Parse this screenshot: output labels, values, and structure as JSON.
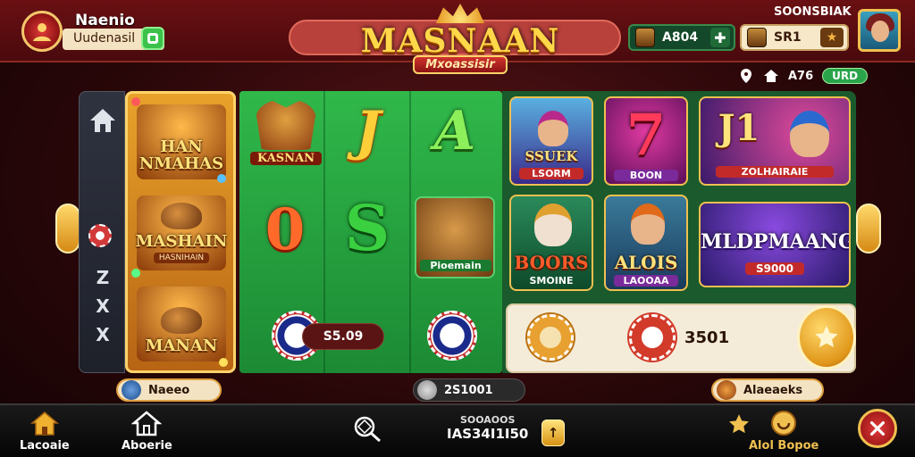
{
  "header": {
    "player_name": "Naenio",
    "player_sub": "Uudenasil",
    "logo_title": "MASNAAN",
    "logo_ribbon": "Mxoassisir",
    "balance_label": "SOONSBIAK",
    "chip_green_value": "A804",
    "chip_cream_value": "SR1",
    "status_text": "A76",
    "status_badge": "URD"
  },
  "left_rail": {
    "symbols": [
      "Z",
      "X",
      "X"
    ]
  },
  "featured": {
    "cards": [
      {
        "title": "HAN NMAHAS"
      },
      {
        "title": "MASHAIN",
        "sub": "HASNIHAIN"
      },
      {
        "title": "MANAN"
      }
    ]
  },
  "slot_grid": {
    "mask_label": "KASNAN",
    "sym_j": "J",
    "sym_a": "A",
    "sym_0": "0",
    "sym_s": "S",
    "lion_label": "Pioemain",
    "amount": "S5.09"
  },
  "games": [
    {
      "title": "SSUEK",
      "sub": "LSORM"
    },
    {
      "title": "7",
      "sub": "BOON"
    },
    {
      "title": "J1",
      "sub": "ZOLHAIRAIE"
    },
    {
      "title": "BOORS",
      "sub": "SMOINE"
    },
    {
      "title": "ALOIS",
      "sub": "LAOOAA"
    },
    {
      "title": "MLDPMAANG",
      "sub": "S9000"
    }
  ],
  "bet_panel": {
    "amount": "3501"
  },
  "under_row": {
    "left_label": "Naeeo",
    "mid_label": "2S1001",
    "right_label": "Alaeaeks"
  },
  "bottom_nav": {
    "home_label": "Lacoaie",
    "aboerie_label": "Aboerie",
    "counter_top": "SOOAOOS",
    "counter_value": "IAS34I1I50",
    "coin_symbol": "↑",
    "bonus_label": "Alol Bopoe"
  },
  "colors": {
    "background": "#3a0a0c",
    "table_green": "#1c8a34",
    "gold": "#f0c050",
    "brand_red": "#b8413c"
  }
}
